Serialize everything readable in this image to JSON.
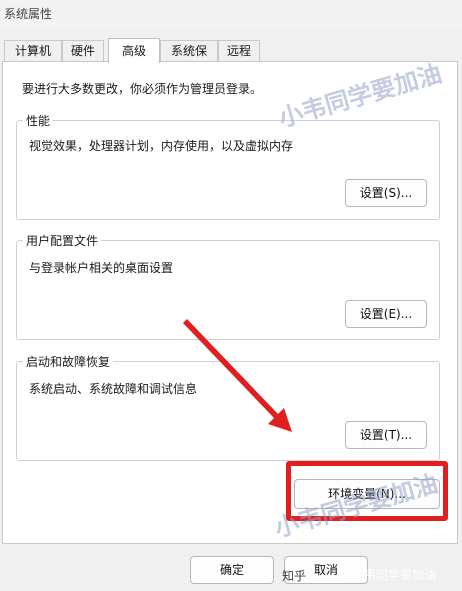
{
  "window": {
    "title": "系统属性"
  },
  "tabs": [
    {
      "label": "计算机名"
    },
    {
      "label": "硬件"
    },
    {
      "label": "高级"
    },
    {
      "label": "系统保护"
    },
    {
      "label": "远程"
    }
  ],
  "notice": "要进行大多数更改，你必须作为管理员登录。",
  "groups": {
    "performance": {
      "label": "性能",
      "desc": "视觉效果，处理器计划，内存使用，以及虚拟内存",
      "button": "设置(S)..."
    },
    "profile": {
      "label": "用户配置文件",
      "desc": "与登录帐户相关的桌面设置",
      "button": "设置(E)..."
    },
    "startup": {
      "label": "启动和故障恢复",
      "desc": "系统启动、系统故障和调试信息",
      "button": "设置(T)..."
    }
  },
  "env_button": "环境变量(N)...",
  "footer": {
    "ok": "确定",
    "cancel": "取消"
  },
  "watermarks": {
    "top": "小韦同学要加油",
    "middle": "小韦同学要加油",
    "zhihu": "知乎",
    "footer": "@小韦同学要加油"
  },
  "colors": {
    "accent_red": "#e02020",
    "panel_bg": "#ffffff",
    "window_bg": "#f0f0f0"
  }
}
